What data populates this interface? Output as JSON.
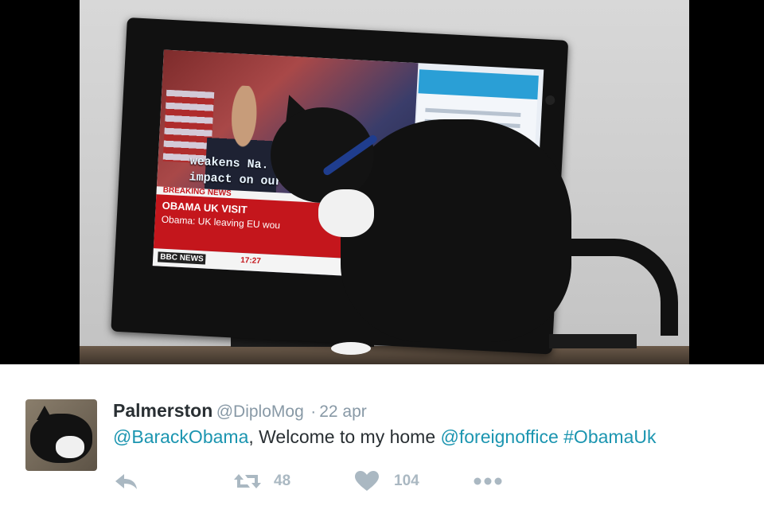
{
  "media": {
    "tv_captions": {
      "line1": "weakens Na.",
      "line2": "impact on our",
      "breaking": "BREAKING NEWS",
      "headline": "OBAMA UK VISIT",
      "subline": "Obama: UK leaving EU wou",
      "network": "BBC NEWS",
      "clock": "17:27"
    }
  },
  "tweet": {
    "display_name": "Palmerston",
    "handle": "@DiploMog",
    "separator": "·",
    "time": "22 apr",
    "mention1": "@BarackObama",
    "text_middle": ", Welcome to my home ",
    "mention2": "@foreignoffice",
    "hashtag": "#ObamaUk",
    "actions": {
      "reply_icon": "reply-icon",
      "retweet_icon": "retweet-icon",
      "retweet_count": "48",
      "like_icon": "heart-icon",
      "like_count": "104",
      "more_icon": "more-dots-icon"
    },
    "colors": {
      "link": "#1b95b0",
      "muted": "#8899a6",
      "icon": "#aab8c2",
      "text": "#292f33"
    }
  }
}
